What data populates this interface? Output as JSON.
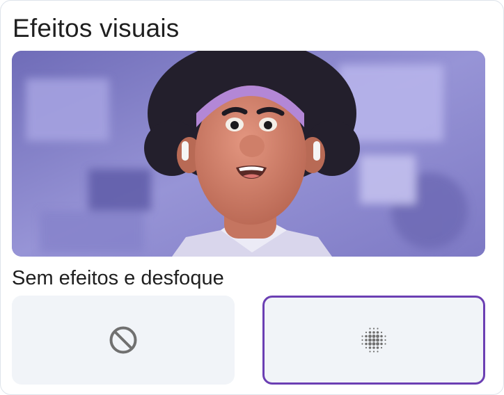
{
  "panel": {
    "title": "Efeitos visuais"
  },
  "preview": {
    "icon": "camera-preview-avatar"
  },
  "section": {
    "label": "Sem efeitos e desfoque"
  },
  "options": [
    {
      "id": "no-effect",
      "icon": "block-icon",
      "selected": false
    },
    {
      "id": "blur-background",
      "icon": "blur-icon",
      "selected": true
    }
  ],
  "colors": {
    "accent": "#6b3fb3",
    "tile_bg": "#f1f4f8",
    "icon_gray": "#707070"
  }
}
